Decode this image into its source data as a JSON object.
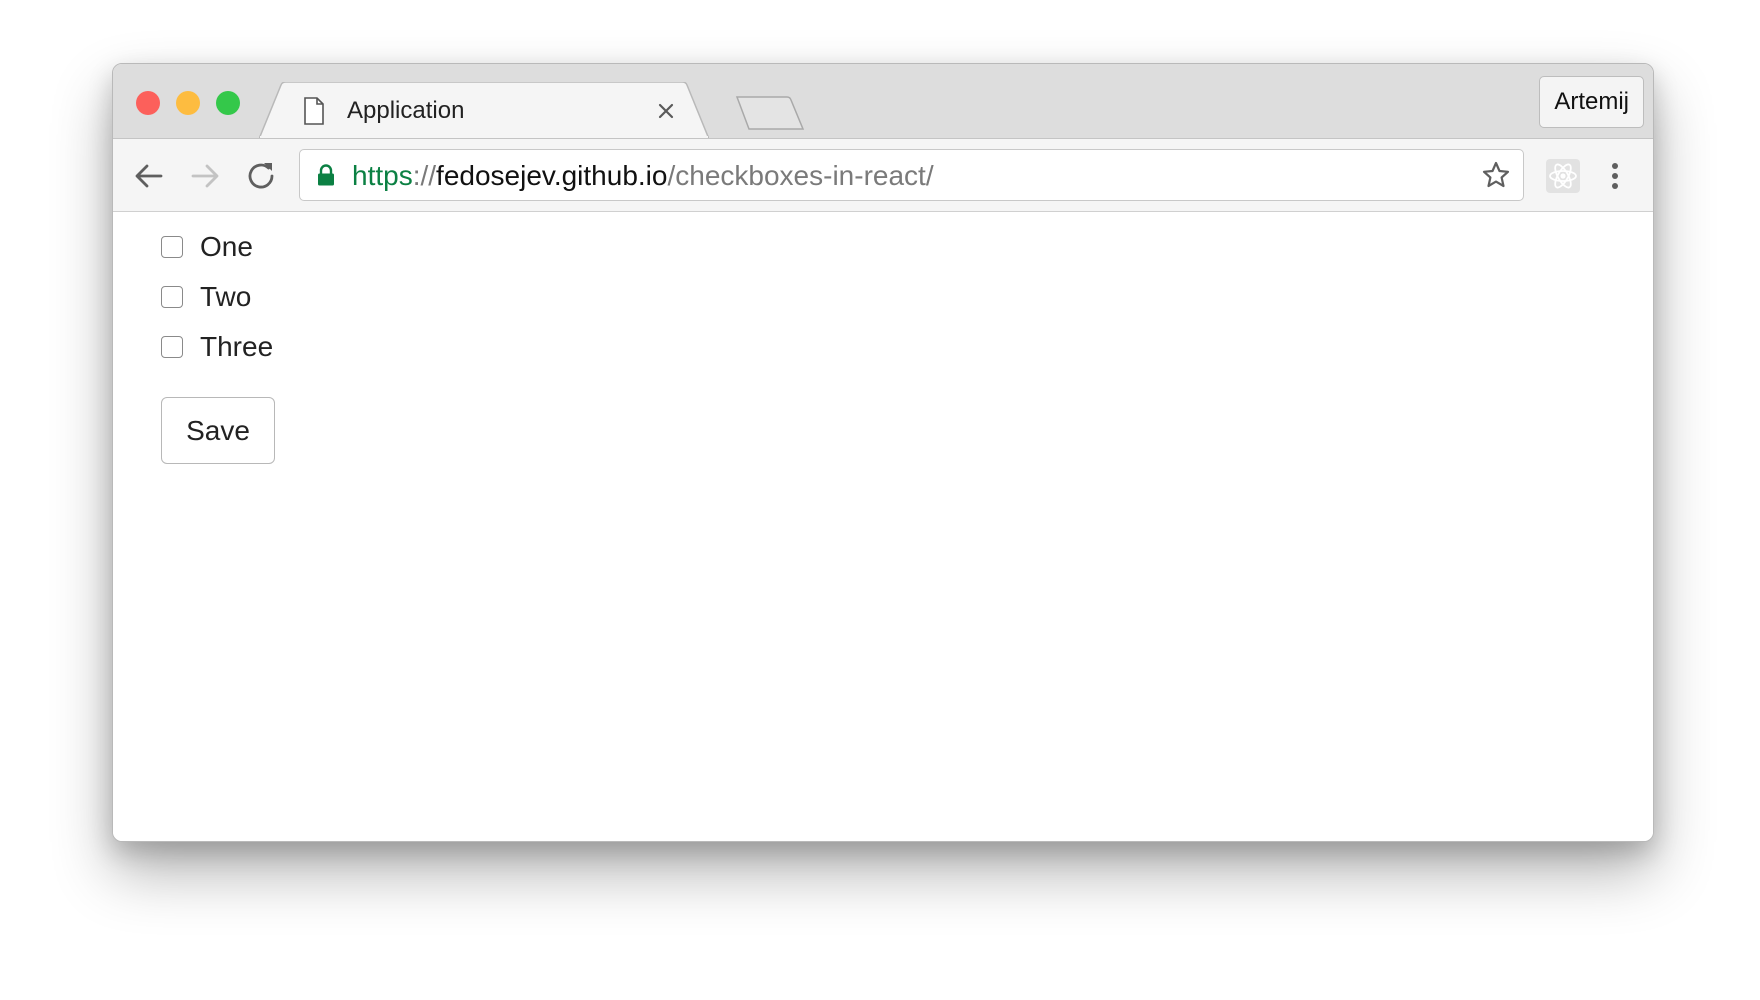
{
  "window": {
    "traffic_lights": {
      "close_color": "#fc605b",
      "minimize_color": "#fdbc40",
      "maximize_color": "#34c84a"
    }
  },
  "tab": {
    "title": "Application",
    "icon": "page-icon",
    "close_icon": "close-icon"
  },
  "new_tab": {
    "icon": "new-tab-icon"
  },
  "profile": {
    "name": "Artemij"
  },
  "toolbar": {
    "back_icon": "arrow-left-icon",
    "forward_icon": "arrow-right-icon",
    "reload_icon": "reload-icon",
    "extension_icon": "react-icon",
    "menu_icon": "kebab-menu-icon"
  },
  "address_bar": {
    "lock_icon": "lock-icon",
    "scheme": "https",
    "separator": "://",
    "host": "fedosejev.github.io",
    "path": "/checkboxes-in-react/",
    "bookmark_icon": "star-icon",
    "secure_color": "#0b8043"
  },
  "page": {
    "checkboxes": [
      {
        "label": "One",
        "checked": false
      },
      {
        "label": "Two",
        "checked": false
      },
      {
        "label": "Three",
        "checked": false
      }
    ],
    "save_label": "Save"
  }
}
